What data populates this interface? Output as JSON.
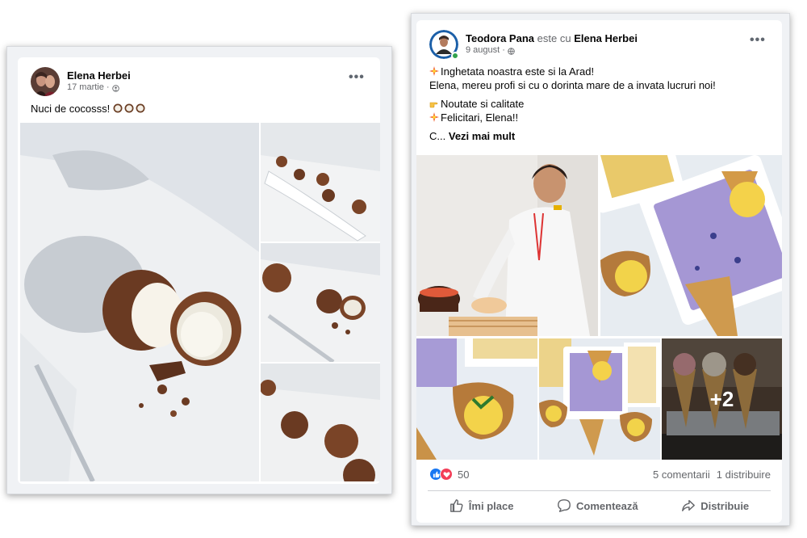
{
  "post1": {
    "author": "Elena Herbei",
    "date": "17 martie",
    "privacy_icon": "friends-icon",
    "more_label": "•••",
    "text": "Nuci de cocosss!",
    "text_emoji": "coconut-emoji",
    "images": [
      "coconut-ice-cream-cut",
      "coconuts-on-board",
      "coconut-halves",
      "coconuts-close"
    ]
  },
  "post2": {
    "author": "Teodora Pana",
    "with_label": "este cu",
    "tagged": "Elena Herbei",
    "date": "9 august",
    "privacy_icon": "globe-icon",
    "more_label": "•••",
    "lines": [
      "Inghetata noastra este si la Arad!",
      "Elena, mereu profi si cu o dorinta mare de a invata lucruri noi!",
      "Noutate si calitate",
      "Felicitari, Elena!!"
    ],
    "truncated_prefix": "C...",
    "see_more": "Vezi mai mult",
    "extra_photos": "+2",
    "reaction_count": "50",
    "comments": "5 comentarii",
    "shares": "1 distribuire",
    "actions": {
      "like": "Îmi place",
      "comment": "Comentează",
      "share": "Distribuie"
    }
  },
  "colors": {
    "fb_blue": "#1877f2",
    "love_red": "#f33e58",
    "online_green": "#31a24c",
    "muted": "#65676b"
  }
}
